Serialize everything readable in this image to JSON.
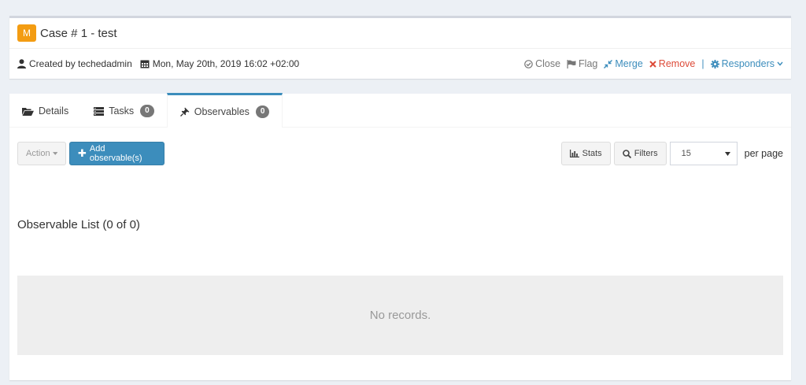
{
  "case": {
    "severity_letter": "M",
    "title": "Case # 1 - test",
    "created_by": "Created by techedadmin",
    "date": "Mon, May 20th, 2019 16:02 +02:00",
    "actions": {
      "close": "Close",
      "flag": "Flag",
      "merge": "Merge",
      "remove": "Remove",
      "responders": "Responders"
    }
  },
  "tabs": [
    {
      "label": "Details"
    },
    {
      "label": "Tasks",
      "count": "0"
    },
    {
      "label": "Observables",
      "count": "0"
    }
  ],
  "toolbar": {
    "action_label": "Action",
    "add_label": "Add observable(s)",
    "stats_label": "Stats",
    "filters_label": "Filters",
    "page_size": "15",
    "per_page_label": "per page"
  },
  "list": {
    "title": "Observable List (0 of 0)",
    "empty_text": "No records."
  },
  "colors": {
    "severity": "#f39c12",
    "primary": "#3c8dbc",
    "danger": "#dd4b39",
    "background": "#ecf0f5"
  }
}
